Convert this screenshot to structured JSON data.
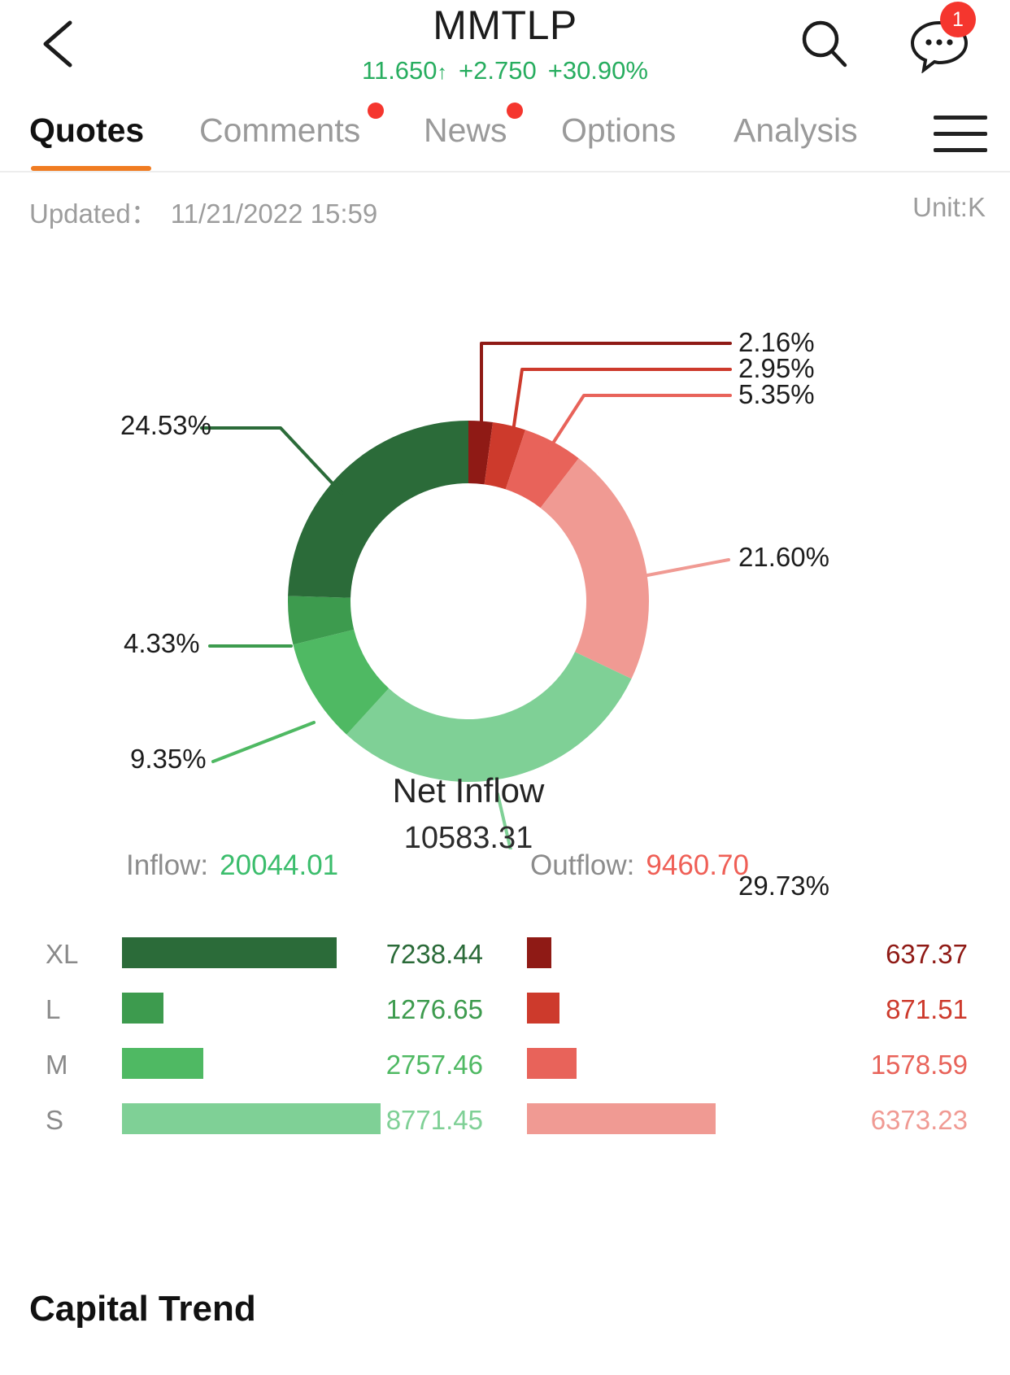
{
  "header": {
    "back_icon": "chevron-left-icon",
    "symbol": "MMTLP",
    "price": "11.650",
    "arrow": "↑",
    "change": "+2.750",
    "change_pct": "+30.90%",
    "quote_color": "#27ad5f",
    "search_icon": "search-icon",
    "chat_icon": "chat-bubble-icon",
    "badge_count": "1",
    "badge_color": "#f5362e"
  },
  "tabs": {
    "items": [
      {
        "label": "Quotes",
        "active": true,
        "dot": false
      },
      {
        "label": "Comments",
        "active": false,
        "dot": true
      },
      {
        "label": "News",
        "active": false,
        "dot": true
      },
      {
        "label": "Options",
        "active": false,
        "dot": false
      },
      {
        "label": "Analysis",
        "active": false,
        "dot": false
      }
    ],
    "menu_icon": "hamburger-menu-icon",
    "active_color": "#f07c22"
  },
  "meta": {
    "updated_label": "Updated：",
    "updated_value": "11/21/2022 15:59",
    "unit": "Unit:K"
  },
  "chart_data": {
    "type": "pie",
    "title": "Net Inflow",
    "center_label": "Net Inflow",
    "center_value": "10583.31",
    "unit": "K",
    "labels": [
      "2.16%",
      "2.95%",
      "5.35%",
      "21.60%",
      "29.73%",
      "9.35%",
      "4.33%",
      "24.53%"
    ],
    "slices": [
      {
        "name": "XL Outflow",
        "label": "2.16%",
        "value": 2.16,
        "color": "#8f1a15"
      },
      {
        "name": "L Outflow",
        "label": "2.95%",
        "value": 2.95,
        "color": "#cd3a2c"
      },
      {
        "name": "M Outflow",
        "label": "5.35%",
        "value": 5.35,
        "color": "#e8635a"
      },
      {
        "name": "S Outflow",
        "label": "21.60%",
        "value": 21.6,
        "color": "#f09a93"
      },
      {
        "name": "S Inflow",
        "label": "29.73%",
        "value": 29.73,
        "color": "#7fd096"
      },
      {
        "name": "M Inflow",
        "label": "9.35%",
        "value": 9.35,
        "color": "#4fb963"
      },
      {
        "name": "L Inflow",
        "label": "4.33%",
        "value": 4.33,
        "color": "#3d9b4e"
      },
      {
        "name": "XL Inflow",
        "label": "24.53%",
        "value": 24.53,
        "color": "#2b6b39"
      }
    ]
  },
  "flow": {
    "inflow_label": "Inflow:",
    "inflow_total": "20044.01",
    "outflow_label": "Outflow:",
    "outflow_total": "9460.70",
    "inflow_color": "#3bbd6c",
    "outflow_color": "#ef5f56",
    "rows": [
      {
        "cat": "XL",
        "in_value": "7238.44",
        "out_value": "637.37",
        "in_width": 264,
        "out_width": 30,
        "in_color": "#2b6b39",
        "out_color": "#8f1a15",
        "in_text_color": "#2b6b39",
        "out_text_color": "#8f1a15"
      },
      {
        "cat": "L",
        "in_value": "1276.65",
        "out_value": "871.51",
        "in_width": 51,
        "out_width": 40,
        "in_color": "#3d9b4e",
        "out_color": "#cd3a2c",
        "in_text_color": "#3d9b4e",
        "out_text_color": "#cd3a2c"
      },
      {
        "cat": "M",
        "in_value": "2757.46",
        "out_value": "1578.59",
        "in_width": 100,
        "out_width": 61,
        "in_color": "#4fb963",
        "out_color": "#e8635a",
        "in_text_color": "#4fb963",
        "out_text_color": "#e8635a"
      },
      {
        "cat": "S",
        "in_value": "8771.45",
        "out_value": "6373.23",
        "in_width": 318,
        "out_width": 232,
        "in_color": "#7fd096",
        "out_color": "#f09a93",
        "in_text_color": "#7fd096",
        "out_text_color": "#f09a93"
      }
    ]
  },
  "footer": {
    "capital_trend": "Capital Trend"
  }
}
